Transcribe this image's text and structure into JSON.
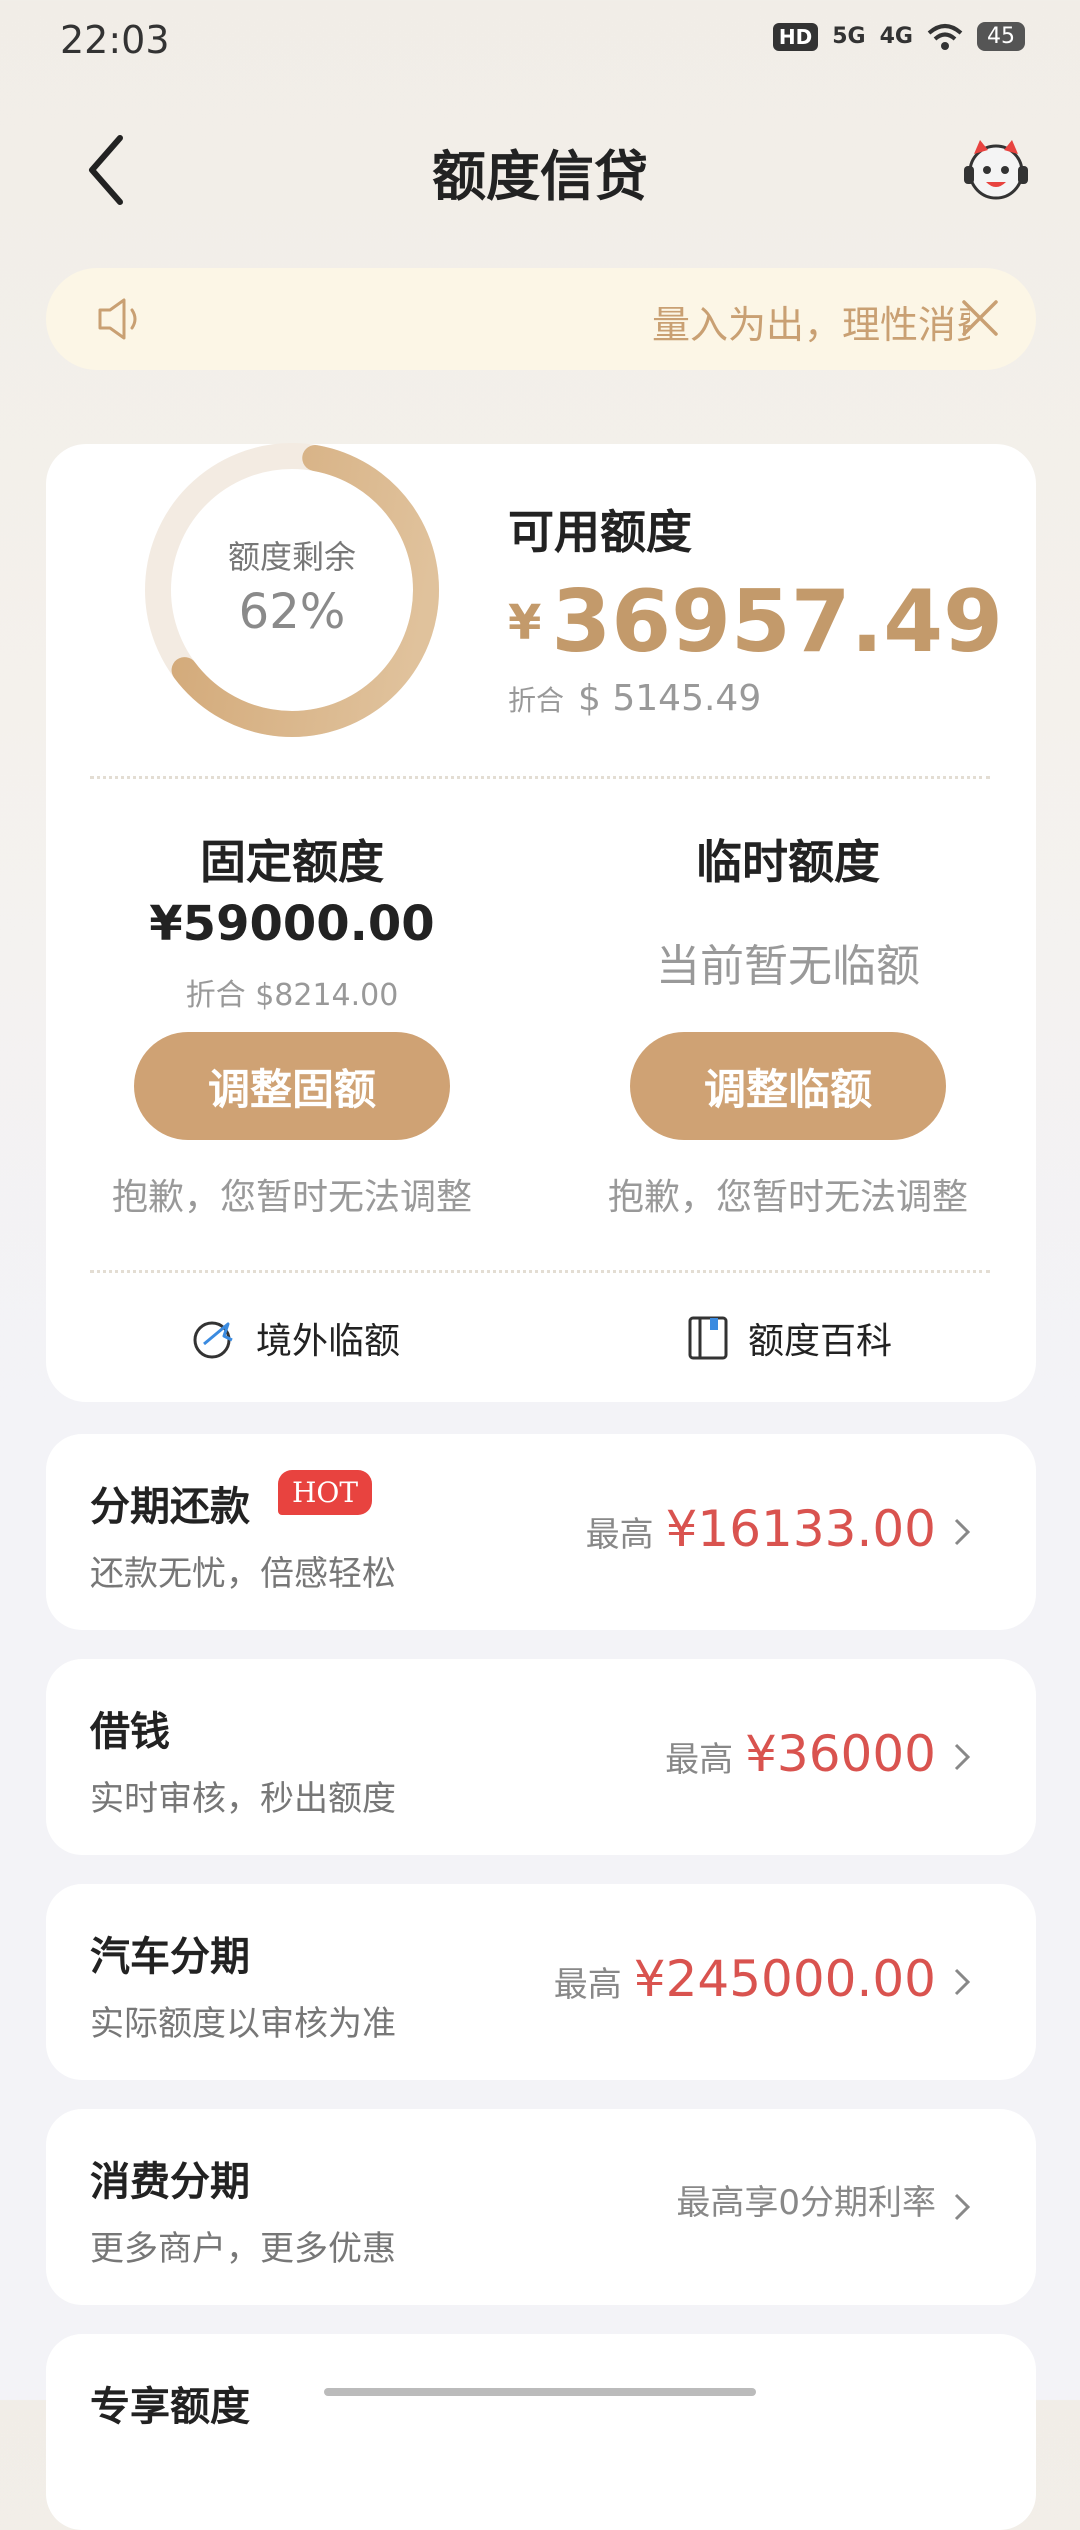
{
  "status_bar": {
    "time": "22:03",
    "hd": "HD",
    "net1": "5G",
    "net2": "4G",
    "battery": "45"
  },
  "header": {
    "title": "额度信贷",
    "back_icon": "chevron-left-icon",
    "mascot_icon": "mascot-icon"
  },
  "notice": {
    "text": "量入为出，理性消费",
    "speaker_icon": "speaker-icon",
    "close_icon": "close-icon"
  },
  "credit": {
    "ring_label": "额度剩余",
    "ring_percent": "62%",
    "ring_fraction": 0.62,
    "available_label": "可用额度",
    "available_currency": "¥",
    "available_amount": "36957.49",
    "available_conv_prefix": "折合",
    "available_conv_value": "$ 5145.49",
    "fixed_title": "固定额度",
    "fixed_amount": "¥59000.00",
    "fixed_conv": "折合 $8214.00",
    "fixed_button": "调整固额",
    "fixed_note": "抱歉，您暂时无法调整",
    "temp_title": "临时额度",
    "temp_none": "当前暂无临额",
    "temp_button": "调整临额",
    "temp_note": "抱歉，您暂时无法调整",
    "link_overseas": "境外临额",
    "link_wiki": "额度百科"
  },
  "list": [
    {
      "title": "分期还款",
      "badge": "HOT",
      "subtitle": "还款无忧，倍感轻松",
      "prefix": "最高",
      "amount": "¥16133.00"
    },
    {
      "title": "借钱",
      "subtitle": "实时审核，秒出额度",
      "prefix": "最高",
      "amount": "¥36000"
    },
    {
      "title": "汽车分期",
      "subtitle": "实际额度以审核为准",
      "prefix": "最高",
      "amount": "¥245000.00"
    },
    {
      "title": "消费分期",
      "subtitle": "更多商户，更多优惠",
      "prefix": "最高享0分期利率",
      "amount": ""
    },
    {
      "title": "专享额度"
    }
  ],
  "colors": {
    "accent": "#cfa274",
    "red": "#d9534f",
    "amount_gold": "#c39a6b"
  }
}
